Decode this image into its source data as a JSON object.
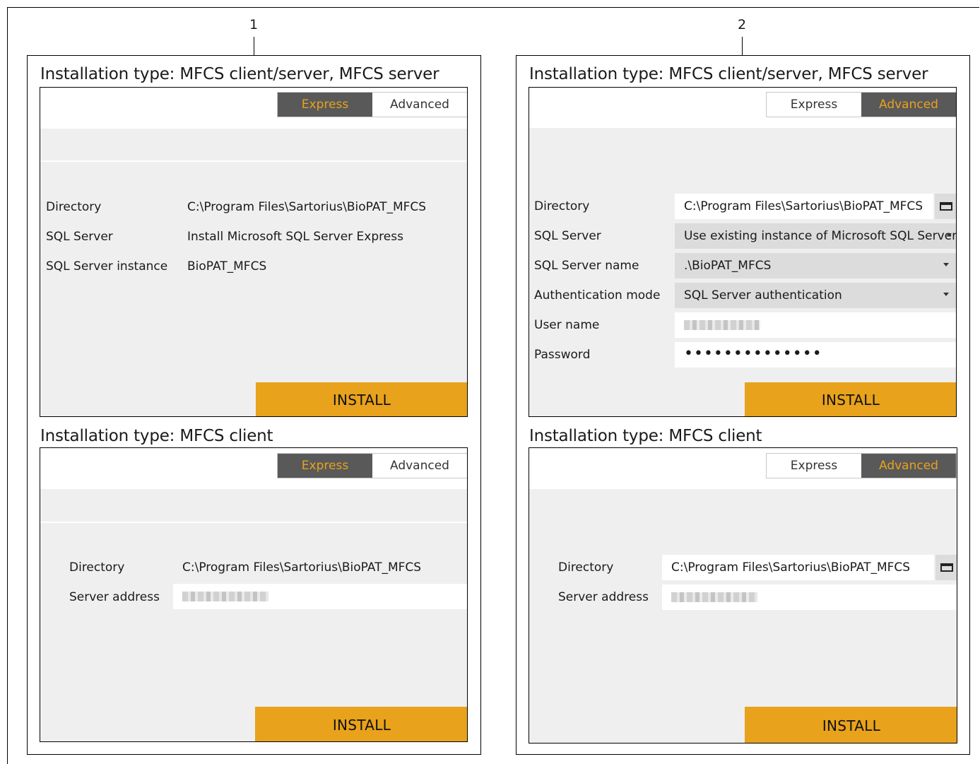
{
  "callouts": {
    "left": "1",
    "right": "2"
  },
  "left": {
    "server": {
      "title": "Installation type: MFCS client/server, MFCS server",
      "toggle": {
        "express": "Express",
        "advanced": "Advanced",
        "active": "express"
      },
      "rows": [
        {
          "label": "Directory",
          "value": "C:\\Program Files\\Sartorius\\BioPAT_MFCS"
        },
        {
          "label": "SQL Server",
          "value": "Install Microsoft SQL Server Express"
        },
        {
          "label": "SQL Server instance",
          "value": "BioPAT_MFCS"
        }
      ],
      "install": "INSTALL"
    },
    "client": {
      "title": "Installation type: MFCS client",
      "toggle": {
        "express": "Express",
        "advanced": "Advanced",
        "active": "express"
      },
      "directory_label": "Directory",
      "directory_value": "C:\\Program Files\\Sartorius\\BioPAT_MFCS",
      "server_address_label": "Server address",
      "install": "INSTALL"
    }
  },
  "right": {
    "server": {
      "title": "Installation type: MFCS client/server, MFCS server",
      "toggle": {
        "express": "Express",
        "advanced": "Advanced",
        "active": "advanced"
      },
      "directory_label": "Directory",
      "directory_value": "C:\\Program Files\\Sartorius\\BioPAT_MFCS",
      "sql_server_label": "SQL Server",
      "sql_server_value": "Use existing instance of Microsoft SQL Server",
      "sql_server_name_label": "SQL Server name",
      "sql_server_name_value": ".\\BioPAT_MFCS",
      "auth_mode_label": "Authentication mode",
      "auth_mode_value": "SQL Server authentication",
      "user_name_label": "User name",
      "password_label": "Password",
      "password_value": "••••••••••••••",
      "install": "INSTALL"
    },
    "client": {
      "title": "Installation type: MFCS client",
      "toggle": {
        "express": "Express",
        "advanced": "Advanced",
        "active": "advanced"
      },
      "directory_label": "Directory",
      "directory_value": "C:\\Program Files\\Sartorius\\BioPAT_MFCS",
      "server_address_label": "Server address",
      "install": "INSTALL"
    }
  },
  "colors": {
    "accent": "#e8a21b",
    "toggle_active_bg": "#595959",
    "panel_bg": "#efefef"
  },
  "icons": {
    "browse": "folder-icon",
    "dropdown": "chevron-down-icon"
  }
}
